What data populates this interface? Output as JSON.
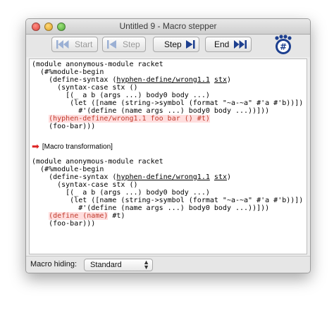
{
  "window": {
    "title": "Untitled 9 - Macro stepper"
  },
  "toolbar": {
    "start_label": "Start",
    "step_back_label": "Step",
    "step_label": "Step",
    "end_label": "End"
  },
  "code_before": [
    "(module anonymous-module racket",
    "  (#%module-begin",
    "    (define-syntax (hyphen-define/wrong1.1 stx)",
    "      (syntax-case stx ()",
    "        [(_ a b (args ...) body0 body ...)",
    "         (let ([name (string->symbol (format \"~a-~a\" #'a #'b))])",
    "           #'(define (name args ...) body0 body ...))]))",
    "    (hyphen-define/wrong1.1 foo bar () #t)",
    "    (foo-bar)))"
  ],
  "step_label": "[Macro transformation]",
  "code_after": [
    "(module anonymous-module racket",
    "  (#%module-begin",
    "    (define-syntax (hyphen-define/wrong1.1 stx)",
    "      (syntax-case stx ()",
    "        [(_ a b (args ...) body0 body ...)",
    "         (let ([name (string->symbol (format \"~a-~a\" #'a #'b))])",
    "           #'(define (name args ...) body0 body ...))]))",
    "    (define (name) #t)",
    "    (foo-bar)))"
  ],
  "bottom": {
    "macro_hiding_label": "Macro hiding:",
    "macro_hiding_value": "Standard"
  },
  "colors": {
    "highlight_bg": "#ffdede",
    "highlight_text": "#c0392b",
    "arrow": "#dd2222",
    "step_icon": "#1d3f8f"
  }
}
